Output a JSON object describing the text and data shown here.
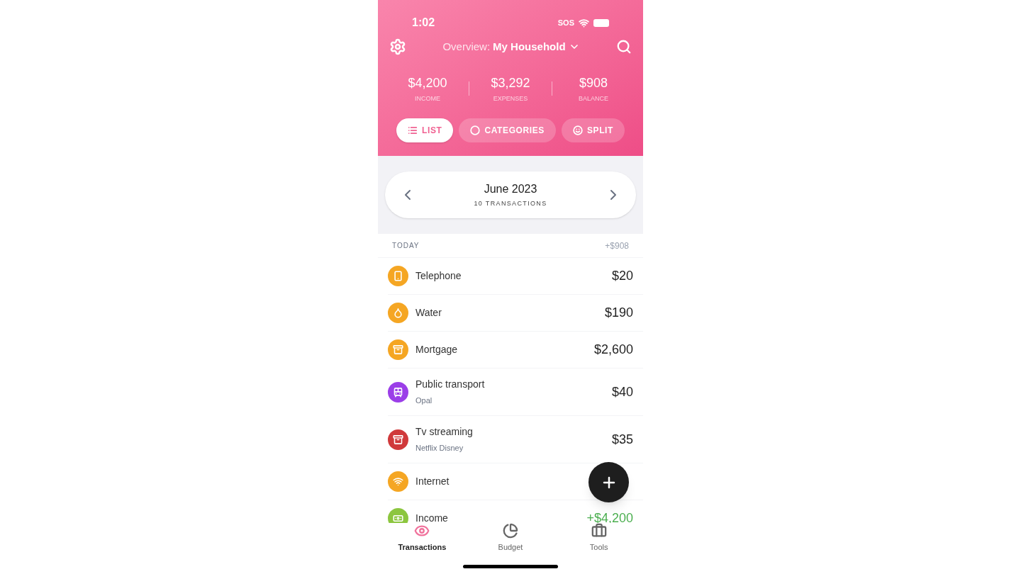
{
  "status_bar": {
    "time": "1:02",
    "carrier": "SOS"
  },
  "header": {
    "title_prefix": "Overview:",
    "title": "My Household"
  },
  "summary": [
    {
      "value": "$4,200",
      "label": "INCOME"
    },
    {
      "value": "$3,292",
      "label": "EXPENSES"
    },
    {
      "value": "$908",
      "label": "BALANCE"
    }
  ],
  "view_tabs": [
    {
      "label": "LIST",
      "selected": true
    },
    {
      "label": "CATEGORIES",
      "selected": false
    },
    {
      "label": "SPLIT",
      "selected": false
    }
  ],
  "period": {
    "month": "June 2023",
    "count": "10 TRANSACTIONS"
  },
  "section": {
    "label": "TODAY",
    "total": "+$908"
  },
  "transactions": [
    {
      "name": "Telephone",
      "amount": "$20",
      "color": "#f5a623",
      "kind": "expense"
    },
    {
      "name": "Water",
      "amount": "$190",
      "color": "#f5a623",
      "kind": "expense"
    },
    {
      "name": "Mortgage",
      "amount": "$2,600",
      "color": "#f5a623",
      "kind": "expense"
    },
    {
      "name": "Public transport",
      "note": "Opal",
      "amount": "$40",
      "color": "#9b3ee8",
      "kind": "expense"
    },
    {
      "name": "Tv streaming",
      "note": "Netflix Disney",
      "amount": "$35",
      "color": "#d0393b",
      "kind": "expense"
    },
    {
      "name": "Internet",
      "color": "#f5a623"
    },
    {
      "name": "Income",
      "amount": "+$4,200",
      "color": "#8cc63f",
      "kind": "income"
    }
  ],
  "bottom_tabs": [
    {
      "label": "Transactions",
      "selected": true
    },
    {
      "label": "Budget",
      "selected": false
    },
    {
      "label": "Tools",
      "selected": false
    }
  ]
}
